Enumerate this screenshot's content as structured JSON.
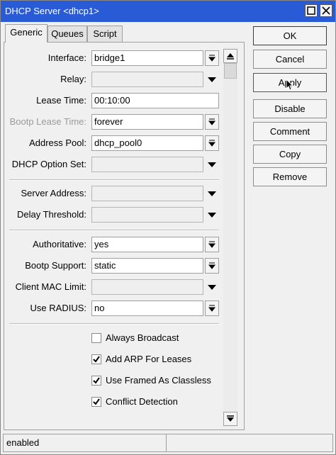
{
  "window": {
    "title": "DHCP Server <dhcp1>"
  },
  "tabs": [
    {
      "label": "Generic",
      "active": true
    },
    {
      "label": "Queues",
      "active": false
    },
    {
      "label": "Script",
      "active": false
    }
  ],
  "fields": {
    "interface": {
      "label": "Interface:",
      "value": "bridge1"
    },
    "relay": {
      "label": "Relay:",
      "value": ""
    },
    "lease_time": {
      "label": "Lease Time:",
      "value": "00:10:00"
    },
    "bootp_lease_time": {
      "label": "Bootp Lease Time:",
      "value": "forever"
    },
    "address_pool": {
      "label": "Address Pool:",
      "value": "dhcp_pool0"
    },
    "dhcp_option_set": {
      "label": "DHCP Option Set:",
      "value": ""
    },
    "server_address": {
      "label": "Server Address:",
      "value": ""
    },
    "delay_threshold": {
      "label": "Delay Threshold:",
      "value": ""
    },
    "authoritative": {
      "label": "Authoritative:",
      "value": "yes"
    },
    "bootp_support": {
      "label": "Bootp Support:",
      "value": "static"
    },
    "client_mac_limit": {
      "label": "Client MAC Limit:",
      "value": ""
    },
    "use_radius": {
      "label": "Use RADIUS:",
      "value": "no"
    }
  },
  "checkboxes": [
    {
      "label": "Always Broadcast",
      "checked": false
    },
    {
      "label": "Add ARP For Leases",
      "checked": true
    },
    {
      "label": "Use Framed As Classless",
      "checked": true
    },
    {
      "label": "Conflict Detection",
      "checked": true
    }
  ],
  "actions": {
    "ok": "OK",
    "cancel": "Cancel",
    "apply": "Apply",
    "disable": "Disable",
    "comment": "Comment",
    "copy": "Copy",
    "remove": "Remove"
  },
  "status": {
    "state": "enabled",
    "extra": ""
  },
  "colors": {
    "titlebar": "#2a5bd7",
    "background": "#f0f0f0"
  }
}
